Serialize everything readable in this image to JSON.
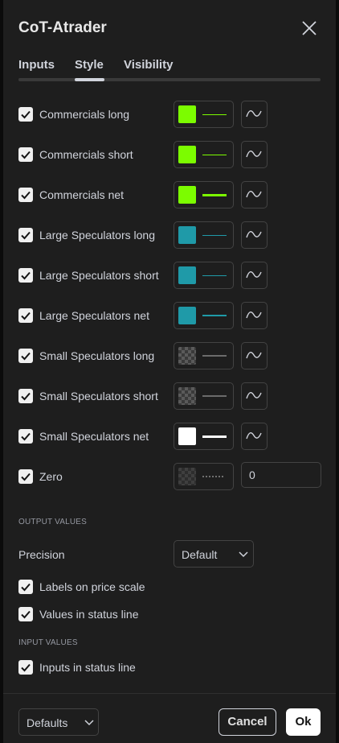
{
  "dialog": {
    "title": "CoT-Atrader",
    "tabs": [
      "Inputs",
      "Style",
      "Visibility"
    ],
    "active_tab": "Style"
  },
  "plots": [
    {
      "label": "Commercials long",
      "checked": true,
      "color": "#7cfc00",
      "line": "thin"
    },
    {
      "label": "Commercials short",
      "checked": true,
      "color": "#7cfc00",
      "line": "thin"
    },
    {
      "label": "Commercials net",
      "checked": true,
      "color": "#7cfc00",
      "line": "thick"
    },
    {
      "label": "Large Speculators long",
      "checked": true,
      "color": "#1f9aa8",
      "line": "thin"
    },
    {
      "label": "Large Speculators short",
      "checked": true,
      "color": "#1f9aa8",
      "line": "thin"
    },
    {
      "label": "Large Speculators net",
      "checked": true,
      "color": "#1f9aa8",
      "line": "medium"
    },
    {
      "label": "Small Speculators long",
      "checked": true,
      "color": "transparent",
      "line": "medium"
    },
    {
      "label": "Small Speculators short",
      "checked": true,
      "color": "transparent",
      "line": "medium"
    },
    {
      "label": "Small Speculators net",
      "checked": true,
      "color": "#ffffff",
      "line": "thick"
    }
  ],
  "zero": {
    "label": "Zero",
    "checked": true,
    "color": "transparent",
    "line": "dotted",
    "value": "0"
  },
  "output_values": {
    "heading": "OUTPUT VALUES",
    "precision_label": "Precision",
    "precision_value": "Default",
    "labels_on_price_scale": "Labels on price scale",
    "values_in_status_line": "Values in status line"
  },
  "input_values": {
    "heading": "INPUT VALUES",
    "inputs_in_status_line": "Inputs in status line"
  },
  "footer": {
    "defaults_label": "Defaults",
    "cancel_label": "Cancel",
    "ok_label": "Ok"
  },
  "icons": {
    "close": "close-icon",
    "checkbox": "checkmark-icon",
    "plot_type": "line-plot-icon",
    "dropdown": "chevron-down-icon"
  }
}
